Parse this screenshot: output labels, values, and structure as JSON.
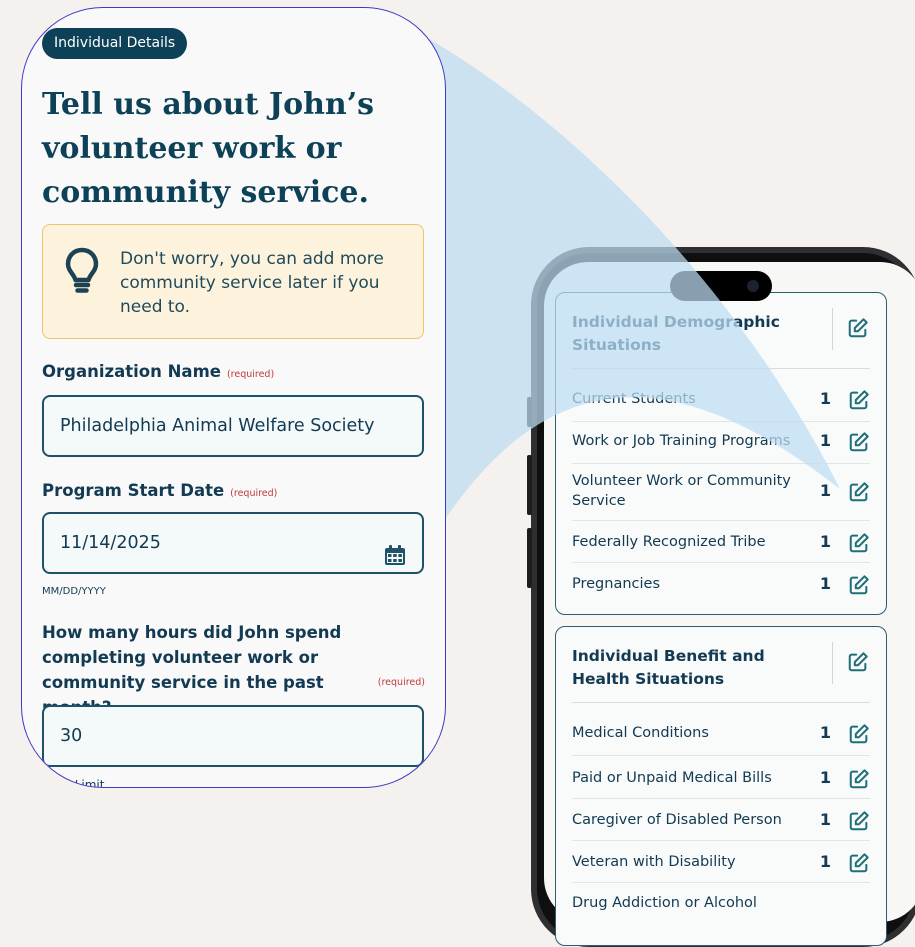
{
  "form": {
    "badge": "Individual Details",
    "title": "Tell us about John’s volunteer work or community service.",
    "notice": "Don't worry, you can add more community service later if you need to.",
    "org_label": "Organization Name",
    "required": "(required)",
    "org_value": "Philadelphia Animal Welfare Society",
    "date_label": "Program Start Date",
    "date_value": "11/14/2025",
    "date_hint": "MM/DD/YYYY",
    "hours_question": "How many hours did John spend completing volunteer work or community service in the past month?",
    "hours_value": "30",
    "hours_hint": "Hour Limit"
  },
  "summary": {
    "demographic": {
      "heading": "Individual Demographic Situations",
      "rows": [
        {
          "label": "Current Students",
          "count": "1"
        },
        {
          "label": "Work or Job Training Programs",
          "count": "1"
        },
        {
          "label": "Volunteer Work or Community Service",
          "count": "1"
        },
        {
          "label": "Federally Recognized Tribe",
          "count": "1"
        },
        {
          "label": "Pregnancies",
          "count": "1"
        }
      ]
    },
    "benefit": {
      "heading": "Individual Benefit and Health Situations",
      "rows": [
        {
          "label": "Medical Conditions",
          "count": "1"
        },
        {
          "label": "Paid or Unpaid Medical Bills",
          "count": "1"
        },
        {
          "label": "Caregiver of Disabled Person",
          "count": "1"
        },
        {
          "label": "Veteran with Disability",
          "count": "1"
        },
        {
          "label": "Drug Addiction or Alcohol",
          "count": ""
        }
      ]
    }
  },
  "icons": {
    "edit": "pencil-square-icon",
    "calendar": "calendar-icon",
    "tip": "lightbulb-icon"
  },
  "colors": {
    "accent": "#0d4157",
    "icon_teal": "#1f6f7a",
    "required": "#c33a3a",
    "notice_bg": "#fdf3dc",
    "notice_border": "#e9c56c"
  }
}
